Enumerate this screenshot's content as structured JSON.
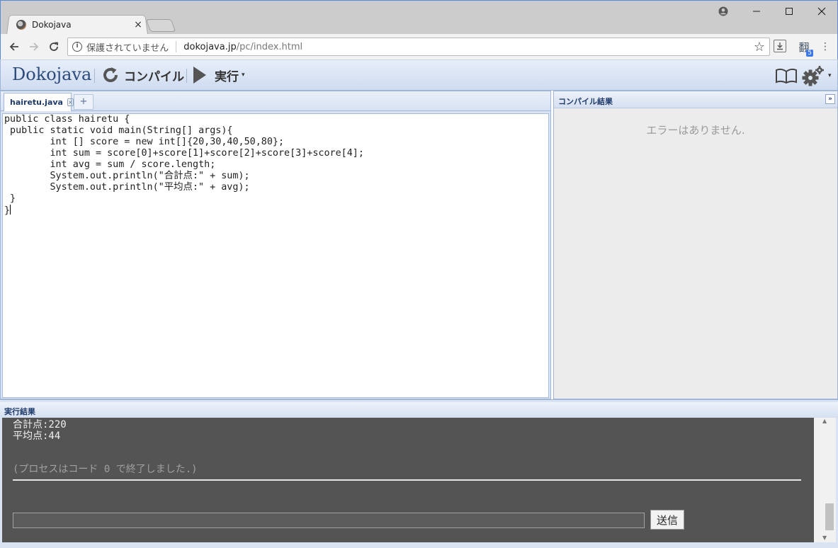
{
  "browser": {
    "tab_title": "Dokojava",
    "tab_close": "×",
    "not_secure": "保護されていません",
    "url_host": "dokojava.jp",
    "url_path": "/pc/index.html",
    "ext_badge": "5",
    "ext_glyph": "翻",
    "menu_glyph": "⋮"
  },
  "toolbar": {
    "logo": "Dokojava",
    "compile_label": "コンパイル",
    "run_label": "実行",
    "run_caret": "▾",
    "gear_caret": "▾"
  },
  "editor": {
    "file_tab": "hairetu.java",
    "file_tab_close": "×",
    "add_tab": "+",
    "code_lines": [
      "public class hairetu {",
      " public static void main(String[] args){",
      "        int [] score = new int[]{20,30,40,50,80};",
      "        int sum = score[0]+score[1]+score[2]+score[3]+score[4];",
      "        int avg = sum / score.length;",
      "        System.out.println(\"合計点:\" + sum);",
      "        System.out.println(\"平均点:\" + avg);",
      " }",
      "}"
    ]
  },
  "compile": {
    "header": "コンパイル結果",
    "collapse": "»",
    "message": "エラーはありません."
  },
  "run": {
    "header": "実行結果",
    "output_lines": [
      "合計点:220",
      "平均点:44"
    ],
    "exit_message": "(プロセスはコード 0 で終了しました.)",
    "send_label": "送信"
  },
  "colors": {
    "accent": "#5a8ad3",
    "toolbar_bg": "#cfdcf0",
    "console_bg": "#545454"
  }
}
